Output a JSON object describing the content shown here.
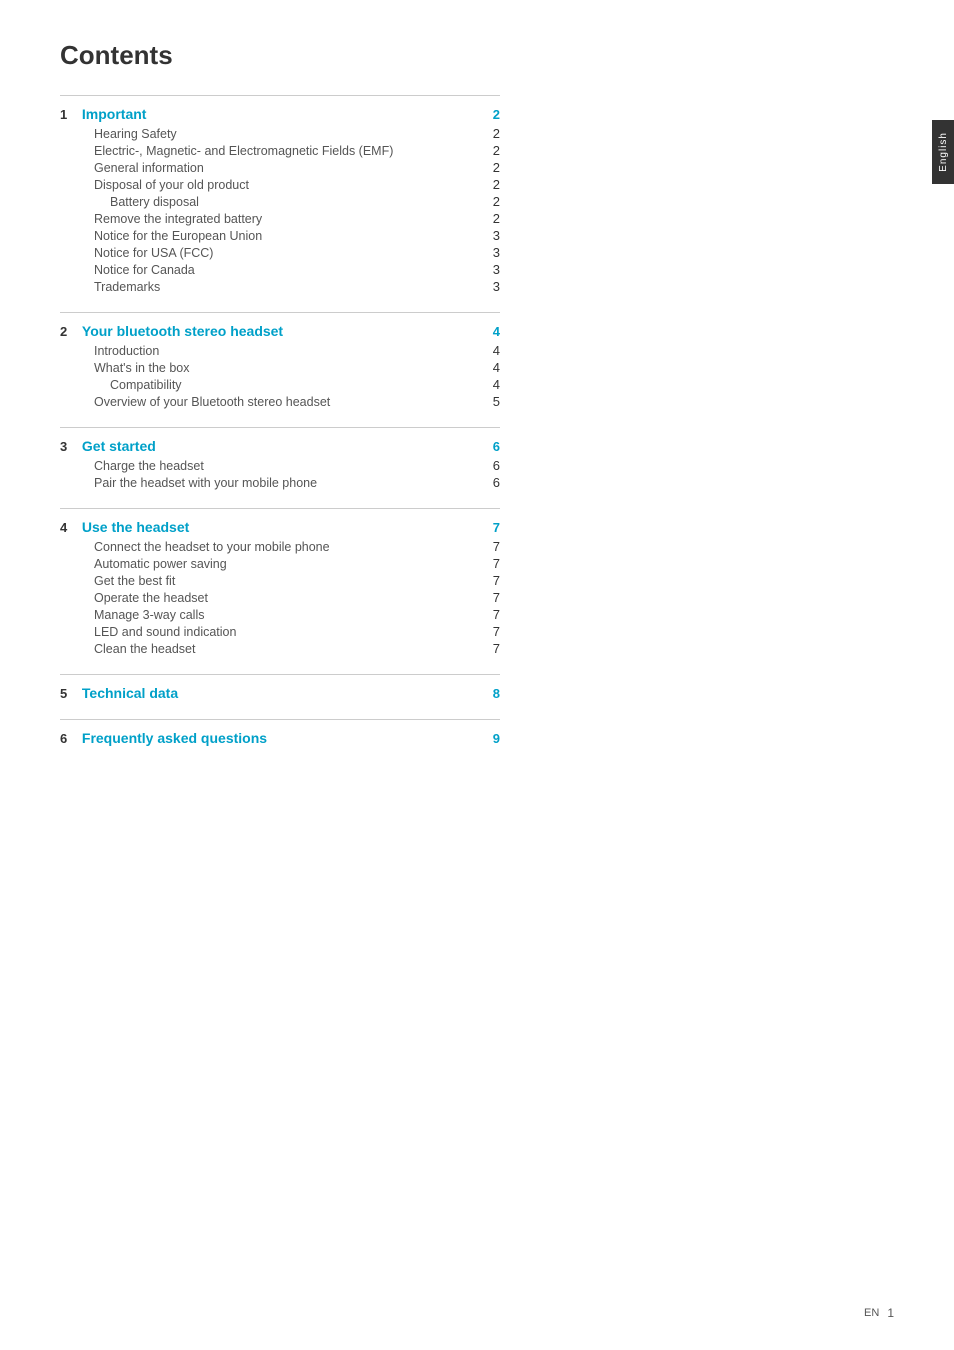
{
  "title": "Contents",
  "side_tab": "English",
  "footer": {
    "label": "EN",
    "page": "1"
  },
  "sections": [
    {
      "number": "1",
      "title": "Important",
      "page": "2",
      "entries": [
        {
          "label": "Hearing Safety",
          "indent": 1,
          "page": "2"
        },
        {
          "label": "Electric-, Magnetic- and Electromagnetic Fields (EMF)",
          "indent": 1,
          "page": "2"
        },
        {
          "label": "General information",
          "indent": 1,
          "page": "2"
        },
        {
          "label": "Disposal of your old product",
          "indent": 1,
          "page": "2"
        },
        {
          "label": "Battery disposal",
          "indent": 2,
          "page": "2"
        },
        {
          "label": "Remove the integrated battery",
          "indent": 1,
          "page": "2"
        },
        {
          "label": "Notice for the European Union",
          "indent": 1,
          "page": "3"
        },
        {
          "label": "Notice for USA (FCC)",
          "indent": 1,
          "page": "3"
        },
        {
          "label": "Notice for Canada",
          "indent": 1,
          "page": "3"
        },
        {
          "label": "Trademarks",
          "indent": 1,
          "page": "3"
        }
      ]
    },
    {
      "number": "2",
      "title": "Your bluetooth stereo headset",
      "page": "4",
      "entries": [
        {
          "label": "Introduction",
          "indent": 1,
          "page": "4"
        },
        {
          "label": "What's in the box",
          "indent": 1,
          "page": "4"
        },
        {
          "label": "Compatibility",
          "indent": 2,
          "page": "4"
        },
        {
          "label": "Overview of your Bluetooth stereo headset",
          "indent": 1,
          "page": "5"
        }
      ]
    },
    {
      "number": "3",
      "title": "Get started",
      "page": "6",
      "entries": [
        {
          "label": "Charge the headset",
          "indent": 1,
          "page": "6"
        },
        {
          "label": "Pair the headset with your mobile phone",
          "indent": 1,
          "page": "6"
        }
      ]
    },
    {
      "number": "4",
      "title": "Use the headset",
      "page": "7",
      "entries": [
        {
          "label": "Connect the headset to your mobile phone",
          "indent": 1,
          "page": "7"
        },
        {
          "label": "Automatic power saving",
          "indent": 1,
          "page": "7"
        },
        {
          "label": "Get the best fit",
          "indent": 1,
          "page": "7"
        },
        {
          "label": "Operate the headset",
          "indent": 1,
          "page": "7"
        },
        {
          "label": "Manage 3-way calls",
          "indent": 1,
          "page": "7"
        },
        {
          "label": "LED and sound indication",
          "indent": 1,
          "page": "7"
        },
        {
          "label": "Clean the headset",
          "indent": 1,
          "page": "7"
        }
      ]
    },
    {
      "number": "5",
      "title": "Technical data",
      "page": "8",
      "entries": []
    },
    {
      "number": "6",
      "title": "Frequently asked questions",
      "page": "9",
      "entries": []
    }
  ]
}
